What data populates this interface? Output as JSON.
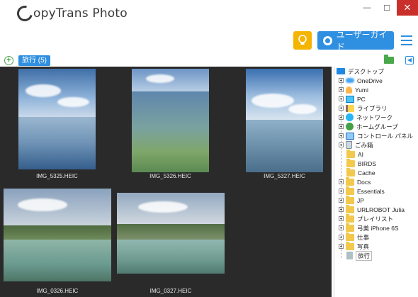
{
  "app": {
    "title": "CopyTrans Photo",
    "title_rest": "opyTrans Photo"
  },
  "window": {
    "minimize_icon": "minimize-icon",
    "maximize_icon": "maximize-icon",
    "close_icon": "close-icon"
  },
  "toolbar": {
    "guide_label": "ユーザーガイド",
    "tip_icon": "lightbulb-icon",
    "menu_icon": "hamburger-menu-icon"
  },
  "album_bar": {
    "current_album": "旅行 (5)",
    "add_icon": "plus-circle-icon",
    "folder_icon": "folder-icon",
    "collapse_icon": "collapse-panel-icon"
  },
  "photos": [
    {
      "filename": "IMG_5325.HEIC"
    },
    {
      "filename": "IMG_5326.HEIC"
    },
    {
      "filename": "IMG_5327.HEIC"
    },
    {
      "filename": "IMG_0326.HEIC"
    },
    {
      "filename": "IMG_0327.HEIC"
    }
  ],
  "tree": {
    "root": "デスクトップ",
    "items": [
      {
        "label": "OneDrive",
        "icon": "onedrive-icon"
      },
      {
        "label": "Yumi",
        "icon": "user-folder-icon"
      },
      {
        "label": "PC",
        "icon": "pc-icon"
      },
      {
        "label": "ライブラリ",
        "icon": "library-icon"
      },
      {
        "label": "ネットワーク",
        "icon": "network-icon"
      },
      {
        "label": "ホームグループ",
        "icon": "homegroup-icon"
      },
      {
        "label": "コントロール パネル",
        "icon": "control-panel-icon"
      },
      {
        "label": "ごみ箱",
        "icon": "recycle-bin-icon"
      },
      {
        "label": "AI",
        "icon": "folder-icon"
      },
      {
        "label": "BIRDS",
        "icon": "folder-icon"
      },
      {
        "label": "Cache",
        "icon": "folder-icon"
      },
      {
        "label": "Docs",
        "icon": "folder-icon"
      },
      {
        "label": "Essentials",
        "icon": "folder-icon"
      },
      {
        "label": "JP",
        "icon": "folder-icon"
      },
      {
        "label": "URLROBOT Julia",
        "icon": "folder-icon"
      },
      {
        "label": "プレイリスト",
        "icon": "folder-icon"
      },
      {
        "label": "弓美 iPhone 6S",
        "icon": "folder-icon"
      },
      {
        "label": "仕事",
        "icon": "folder-icon"
      },
      {
        "label": "写真",
        "icon": "folder-icon"
      },
      {
        "label": "旅行",
        "icon": "album-folder-icon"
      }
    ]
  }
}
